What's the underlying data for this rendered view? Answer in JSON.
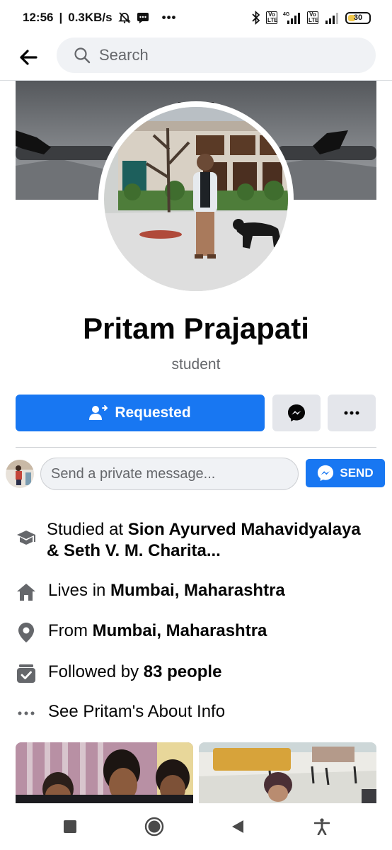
{
  "status_bar": {
    "time": "12:56",
    "speed": "0.3KB/s",
    "network": "4G",
    "volte_label": "Vo LTE",
    "battery": "30"
  },
  "search": {
    "placeholder": "Search"
  },
  "profile": {
    "name": "Pritam Prajapati",
    "bio": "student"
  },
  "actions": {
    "requested_label": "Requested"
  },
  "message": {
    "placeholder": "Send a private message...",
    "send_label": "SEND"
  },
  "about": {
    "education": {
      "prefix": "Studied at ",
      "value": "Sion Ayurved Mahavidyalaya & Seth V. M. Charita..."
    },
    "lives": {
      "prefix": "Lives in ",
      "value": "Mumbai, Maharashtra"
    },
    "from": {
      "prefix": "From ",
      "value": "Mumbai, Maharashtra"
    },
    "followers": {
      "prefix": "Followed by ",
      "value": "83 people"
    },
    "see_about": "See Pritam's About Info"
  },
  "colors": {
    "accent": "#1877f2",
    "secondary_text": "#65676b",
    "button_gray": "#e4e6eb",
    "icon_gray": "#65676b"
  },
  "icons": [
    "back-arrow-icon",
    "search-icon",
    "add-friend-icon",
    "messenger-icon",
    "more-icon",
    "education-icon",
    "home-icon",
    "location-icon",
    "followers-icon",
    "ellipsis-icon",
    "stop-icon",
    "home-circle-icon",
    "back-triangle-icon",
    "accessibility-icon"
  ]
}
